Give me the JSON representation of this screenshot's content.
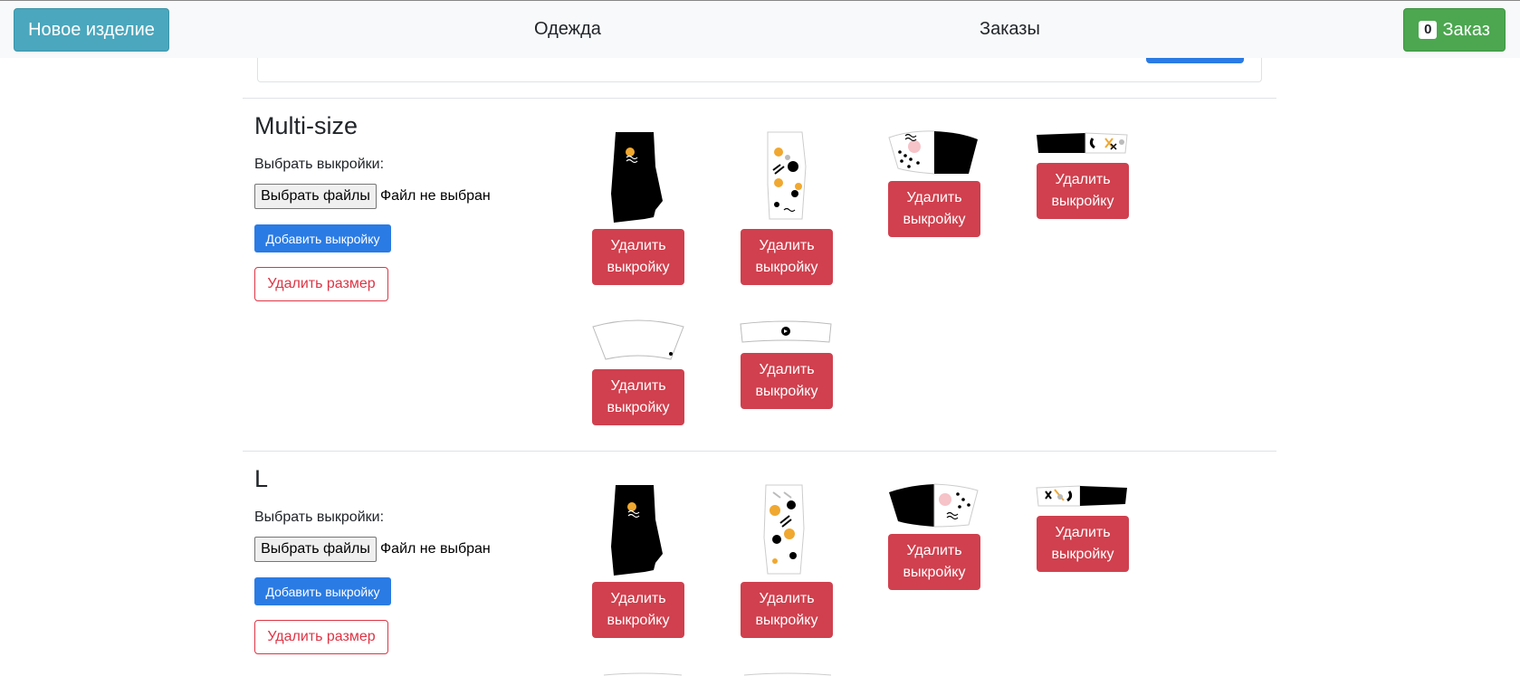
{
  "navbar": {
    "new_item": "Новое изделие",
    "clothes": "Одежда",
    "orders": "Заказы",
    "order_count": "0",
    "order_label": "Заказ"
  },
  "sizes": [
    {
      "title": "Multi-size",
      "choose_label": "Выбрать выкройки:",
      "file_button": "Выбрать файлы",
      "file_status": "Файл не выбран",
      "add_button": "Добавить выкройку",
      "delete_size": "Удалить размер"
    },
    {
      "title": "L",
      "choose_label": "Выбрать выкройки:",
      "file_button": "Выбрать файлы",
      "file_status": "Файл не выбран",
      "add_button": "Добавить выкройку",
      "delete_size": "Удалить размер"
    }
  ],
  "delete_pattern_label": "Удалить выкройку"
}
